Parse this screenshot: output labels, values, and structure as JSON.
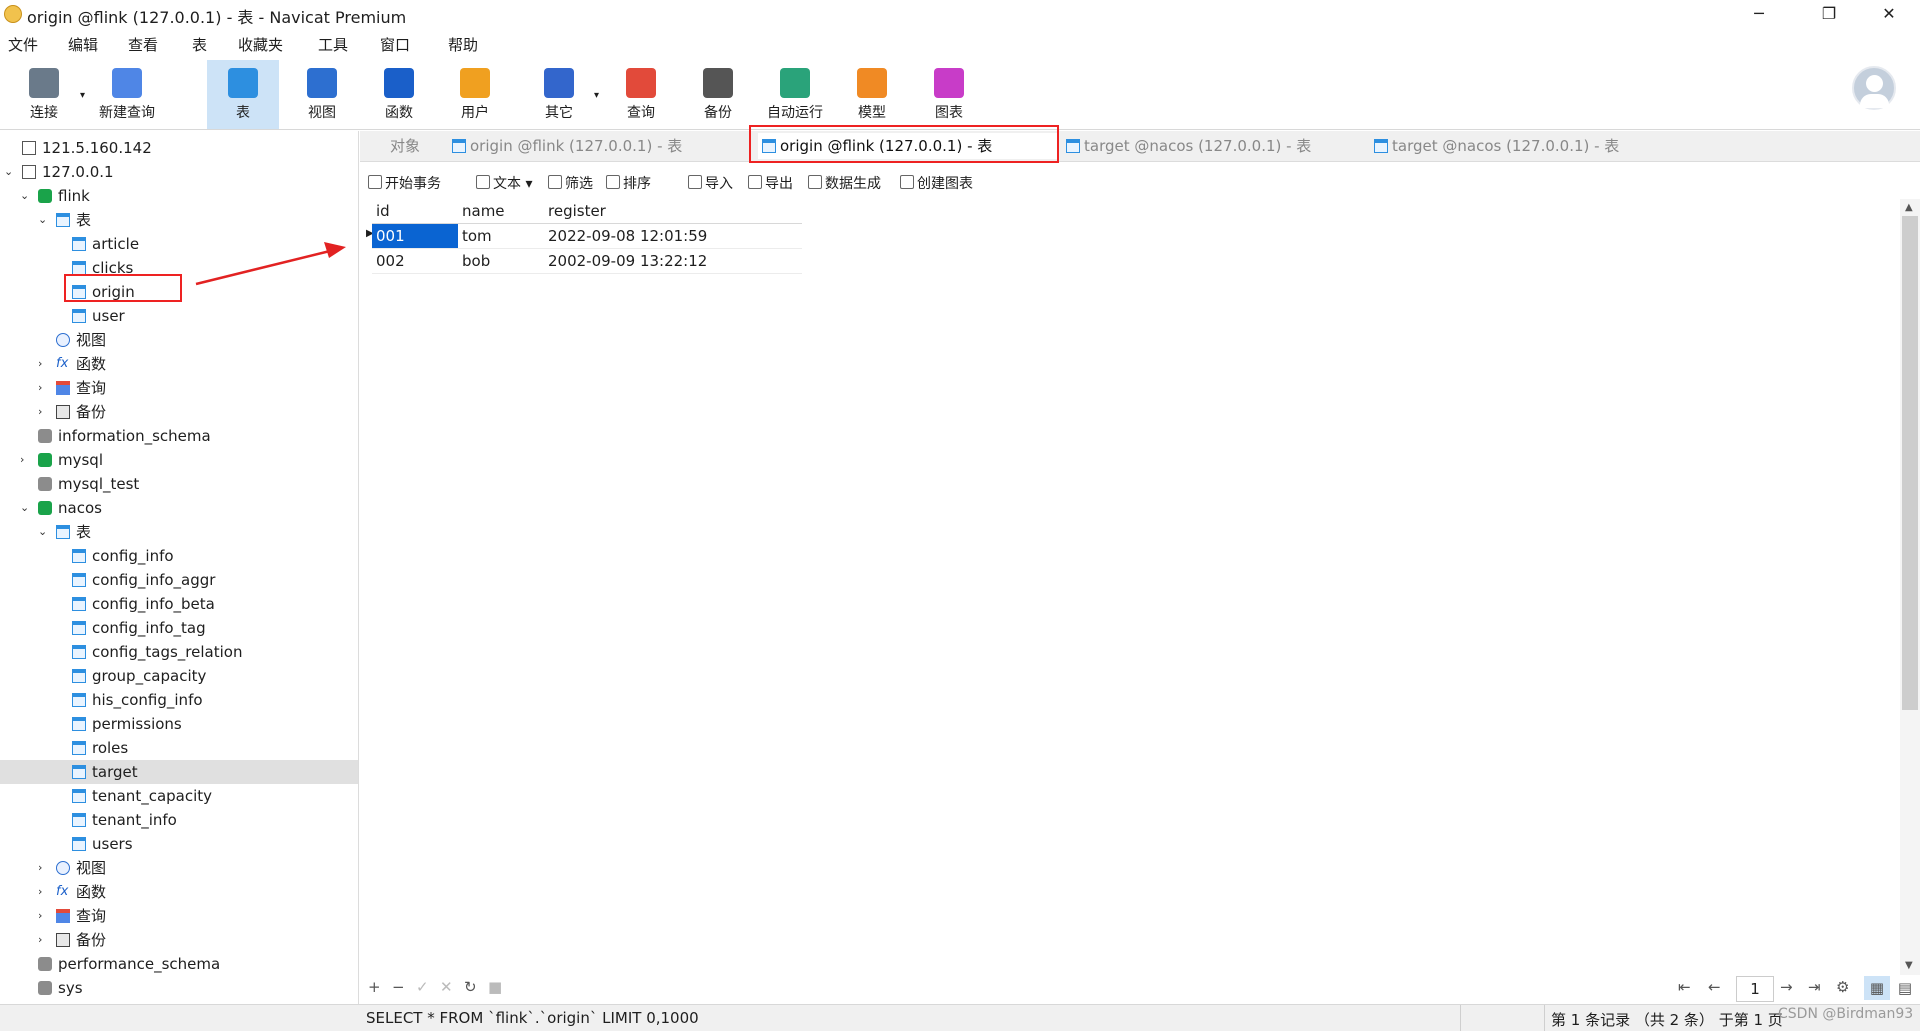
{
  "window": {
    "title": "origin @flink (127.0.0.1) - 表 - Navicat Premium",
    "controls": {
      "minimize": "─",
      "restore": "❐",
      "close": "✕"
    }
  },
  "menu": [
    "文件",
    "编辑",
    "查看",
    "表",
    "收藏夹",
    "工具",
    "窗口",
    "帮助"
  ],
  "toolbar": [
    {
      "label": "连接",
      "icon": "plug-icon",
      "color": "#6a7a8a"
    },
    {
      "label": "新建查询",
      "icon": "new-query-icon",
      "color": "#4f86e6"
    },
    {
      "label": "表",
      "icon": "table-icon",
      "color": "#2d8fe0"
    },
    {
      "label": "视图",
      "icon": "view-icon",
      "color": "#2d6fd0"
    },
    {
      "label": "函数",
      "icon": "function-icon",
      "color": "#1a5fc9"
    },
    {
      "label": "用户",
      "icon": "user-icon",
      "color": "#f0a020"
    },
    {
      "label": "其它",
      "icon": "tools-icon",
      "color": "#3366cc"
    },
    {
      "label": "查询",
      "icon": "query-icon",
      "color": "#e24a3a"
    },
    {
      "label": "备份",
      "icon": "backup-icon",
      "color": "#555555"
    },
    {
      "label": "自动运行",
      "icon": "robot-icon",
      "color": "#2aa37a"
    },
    {
      "label": "模型",
      "icon": "model-icon",
      "color": "#f08a24"
    },
    {
      "label": "图表",
      "icon": "chart-icon",
      "color": "#c83cc8"
    }
  ],
  "tree": [
    {
      "label": "121.5.160.142",
      "level": 0,
      "type": "server",
      "arrow": ""
    },
    {
      "label": "127.0.0.1",
      "level": 0,
      "type": "server",
      "arrow": "⌄"
    },
    {
      "label": "flink",
      "level": 1,
      "type": "db-green",
      "arrow": "⌄"
    },
    {
      "label": "表",
      "level": 2,
      "type": "table",
      "arrow": "⌄"
    },
    {
      "label": "article",
      "level": 3,
      "type": "table",
      "arrow": ""
    },
    {
      "label": "clicks",
      "level": 3,
      "type": "table",
      "arrow": ""
    },
    {
      "label": "origin",
      "level": 3,
      "type": "table",
      "arrow": ""
    },
    {
      "label": "user",
      "level": 3,
      "type": "table",
      "arrow": ""
    },
    {
      "label": "视图",
      "level": 2,
      "type": "view",
      "arrow": ""
    },
    {
      "label": "函数",
      "level": 2,
      "type": "func",
      "arrow": "›"
    },
    {
      "label": "查询",
      "level": 2,
      "type": "query",
      "arrow": "›"
    },
    {
      "label": "备份",
      "level": 2,
      "type": "backup",
      "arrow": "›"
    },
    {
      "label": "information_schema",
      "level": 1,
      "type": "db-gray",
      "arrow": ""
    },
    {
      "label": "mysql",
      "level": 1,
      "type": "db-green",
      "arrow": "›"
    },
    {
      "label": "mysql_test",
      "level": 1,
      "type": "db-gray",
      "arrow": ""
    },
    {
      "label": "nacos",
      "level": 1,
      "type": "db-green",
      "arrow": "⌄"
    },
    {
      "label": "表",
      "level": 2,
      "type": "table",
      "arrow": "⌄"
    },
    {
      "label": "config_info",
      "level": 3,
      "type": "table",
      "arrow": ""
    },
    {
      "label": "config_info_aggr",
      "level": 3,
      "type": "table",
      "arrow": ""
    },
    {
      "label": "config_info_beta",
      "level": 3,
      "type": "table",
      "arrow": ""
    },
    {
      "label": "config_info_tag",
      "level": 3,
      "type": "table",
      "arrow": ""
    },
    {
      "label": "config_tags_relation",
      "level": 3,
      "type": "table",
      "arrow": ""
    },
    {
      "label": "group_capacity",
      "level": 3,
      "type": "table",
      "arrow": ""
    },
    {
      "label": "his_config_info",
      "level": 3,
      "type": "table",
      "arrow": ""
    },
    {
      "label": "permissions",
      "level": 3,
      "type": "table",
      "arrow": ""
    },
    {
      "label": "roles",
      "level": 3,
      "type": "table",
      "arrow": ""
    },
    {
      "label": "target",
      "level": 3,
      "type": "table",
      "arrow": "",
      "selected": true
    },
    {
      "label": "tenant_capacity",
      "level": 3,
      "type": "table",
      "arrow": ""
    },
    {
      "label": "tenant_info",
      "level": 3,
      "type": "table",
      "arrow": ""
    },
    {
      "label": "users",
      "level": 3,
      "type": "table",
      "arrow": ""
    },
    {
      "label": "视图",
      "level": 2,
      "type": "view",
      "arrow": "›"
    },
    {
      "label": "函数",
      "level": 2,
      "type": "func",
      "arrow": "›"
    },
    {
      "label": "查询",
      "level": 2,
      "type": "query",
      "arrow": "›"
    },
    {
      "label": "备份",
      "level": 2,
      "type": "backup",
      "arrow": "›"
    },
    {
      "label": "performance_schema",
      "level": 1,
      "type": "db-gray",
      "arrow": ""
    },
    {
      "label": "sys",
      "level": 1,
      "type": "db-gray",
      "arrow": ""
    }
  ],
  "tabs": [
    {
      "label": "对象",
      "active": false,
      "icon": false
    },
    {
      "label": "origin @flink (127.0.0.1) - 表",
      "active": false,
      "icon": true
    },
    {
      "label": "origin @flink (127.0.0.1) - 表",
      "active": true,
      "icon": true
    },
    {
      "label": "target @nacos (127.0.0.1) - 表",
      "active": false,
      "icon": true
    },
    {
      "label": "target @nacos (127.0.0.1) - 表",
      "active": false,
      "icon": true
    }
  ],
  "subtoolbar": [
    "开始事务",
    "文本",
    "筛选",
    "排序",
    "导入",
    "导出",
    "数据生成",
    "创建图表"
  ],
  "grid": {
    "columns": [
      "id",
      "name",
      "register"
    ],
    "rows": [
      [
        "001",
        "tom",
        "2022-09-08 12:01:59"
      ],
      [
        "002",
        "bob",
        "2002-09-09 13:22:12"
      ]
    ]
  },
  "bottom": {
    "buttons": [
      "+",
      "−",
      "✓",
      "✕",
      "↻",
      "■"
    ],
    "nav": [
      "⇤",
      "←",
      "→",
      "⇥",
      "⚙"
    ],
    "page": "1"
  },
  "status": {
    "sql": "SELECT * FROM `flink`.`origin` LIMIT 0,1000",
    "records": "第 1 条记录 （共 2 条） 于第 1 页"
  },
  "watermark": "CSDN @Birdman93",
  "colors": {
    "accent": "#0a64d2",
    "annotation": "#e22222"
  }
}
